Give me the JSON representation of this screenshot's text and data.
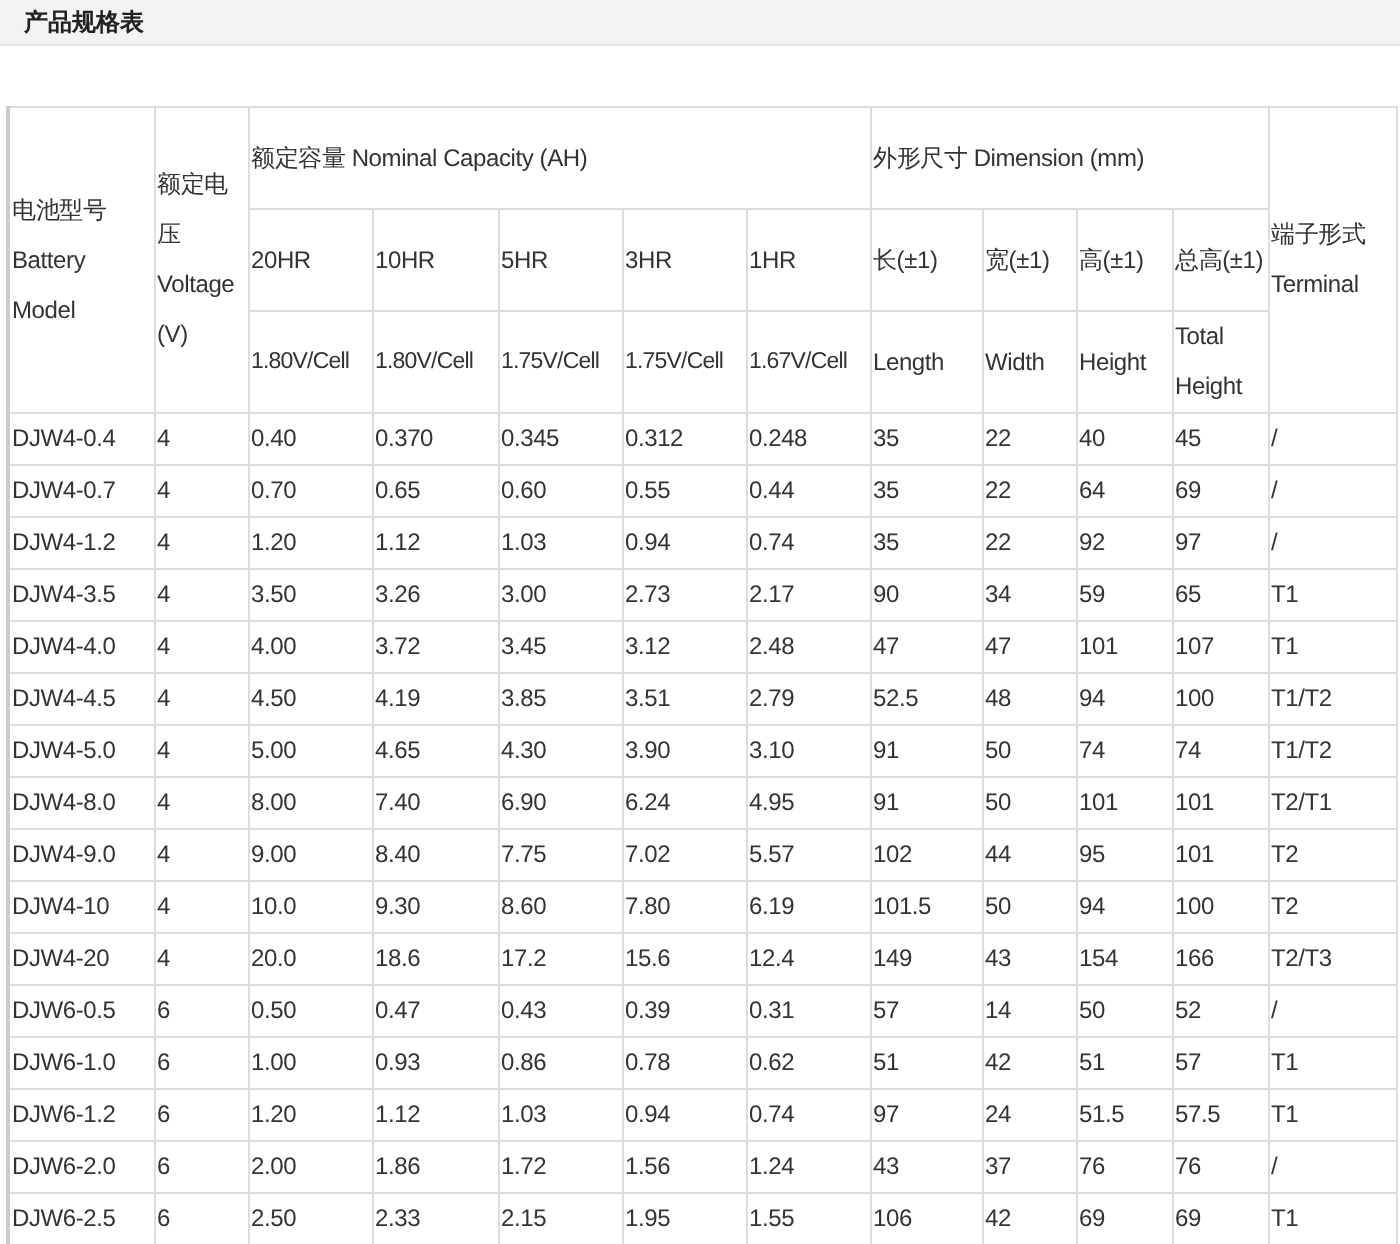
{
  "title": "产品规格表",
  "table": {
    "header": {
      "model": "电池型号 Battery Model",
      "voltage": "额定电压 Voltage (V)",
      "capacity": "额定容量 Nominal Capacity (AH)",
      "dimension": "外形尺寸 Dimension (mm)",
      "terminal": "端子形式 Terminal",
      "rates": [
        "20HR",
        "10HR",
        "5HR",
        "3HR",
        "1HR"
      ],
      "cutoffs": [
        "1.80V/Cell",
        "1.80V/Cell",
        "1.75V/Cell",
        "1.75V/Cell",
        "1.67V/Cell"
      ],
      "dims": [
        "长(±1)",
        "宽(±1)",
        "高(±1)",
        "总高(±1)"
      ],
      "dim_names": [
        "Length",
        "Width",
        "Height",
        "Total Height"
      ]
    },
    "rows": [
      [
        "DJW4-0.4",
        "4",
        "0.40",
        "0.370",
        "0.345",
        "0.312",
        "0.248",
        "35",
        "22",
        "40",
        "45",
        "/"
      ],
      [
        "DJW4-0.7",
        "4",
        "0.70",
        "0.65",
        "0.60",
        "0.55",
        "0.44",
        "35",
        "22",
        "64",
        "69",
        "/"
      ],
      [
        "DJW4-1.2",
        "4",
        "1.20",
        "1.12",
        "1.03",
        "0.94",
        "0.74",
        "35",
        "22",
        "92",
        "97",
        "/"
      ],
      [
        "DJW4-3.5",
        "4",
        "3.50",
        "3.26",
        "3.00",
        "2.73",
        "2.17",
        "90",
        "34",
        "59",
        "65",
        "T1"
      ],
      [
        "DJW4-4.0",
        "4",
        "4.00",
        "3.72",
        "3.45",
        "3.12",
        "2.48",
        "47",
        "47",
        "101",
        "107",
        "T1"
      ],
      [
        "DJW4-4.5",
        "4",
        "4.50",
        "4.19",
        "3.85",
        "3.51",
        "2.79",
        "52.5",
        "48",
        "94",
        "100",
        "T1/T2"
      ],
      [
        "DJW4-5.0",
        "4",
        "5.00",
        "4.65",
        "4.30",
        "3.90",
        "3.10",
        "91",
        "50",
        "74",
        "74",
        "T1/T2"
      ],
      [
        "DJW4-8.0",
        "4",
        "8.00",
        "7.40",
        "6.90",
        "6.24",
        "4.95",
        "91",
        "50",
        "101",
        "101",
        "T2/T1"
      ],
      [
        "DJW4-9.0",
        "4",
        "9.00",
        "8.40",
        "7.75",
        "7.02",
        "5.57",
        "102",
        "44",
        "95",
        "101",
        "T2"
      ],
      [
        "DJW4-10",
        "4",
        "10.0",
        "9.30",
        "8.60",
        "7.80",
        "6.19",
        "101.5",
        "50",
        "94",
        "100",
        "T2"
      ],
      [
        "DJW4-20",
        "4",
        "20.0",
        "18.6",
        "17.2",
        "15.6",
        "12.4",
        "149",
        "43",
        "154",
        "166",
        "T2/T3"
      ],
      [
        "DJW6-0.5",
        "6",
        "0.50",
        "0.47",
        "0.43",
        "0.39",
        "0.31",
        "57",
        "14",
        "50",
        "52",
        "/"
      ],
      [
        "DJW6-1.0",
        "6",
        "1.00",
        "0.93",
        "0.86",
        "0.78",
        "0.62",
        "51",
        "42",
        "51",
        "57",
        "T1"
      ],
      [
        "DJW6-1.2",
        "6",
        "1.20",
        "1.12",
        "1.03",
        "0.94",
        "0.74",
        "97",
        "24",
        "51.5",
        "57.5",
        "T1"
      ],
      [
        "DJW6-2.0",
        "6",
        "2.00",
        "1.86",
        "1.72",
        "1.56",
        "1.24",
        "43",
        "37",
        "76",
        "76",
        "/"
      ],
      [
        "DJW6-2.5",
        "6",
        "2.50",
        "2.33",
        "2.15",
        "1.95",
        "1.55",
        "106",
        "42",
        "69",
        "69",
        "T1"
      ]
    ]
  }
}
